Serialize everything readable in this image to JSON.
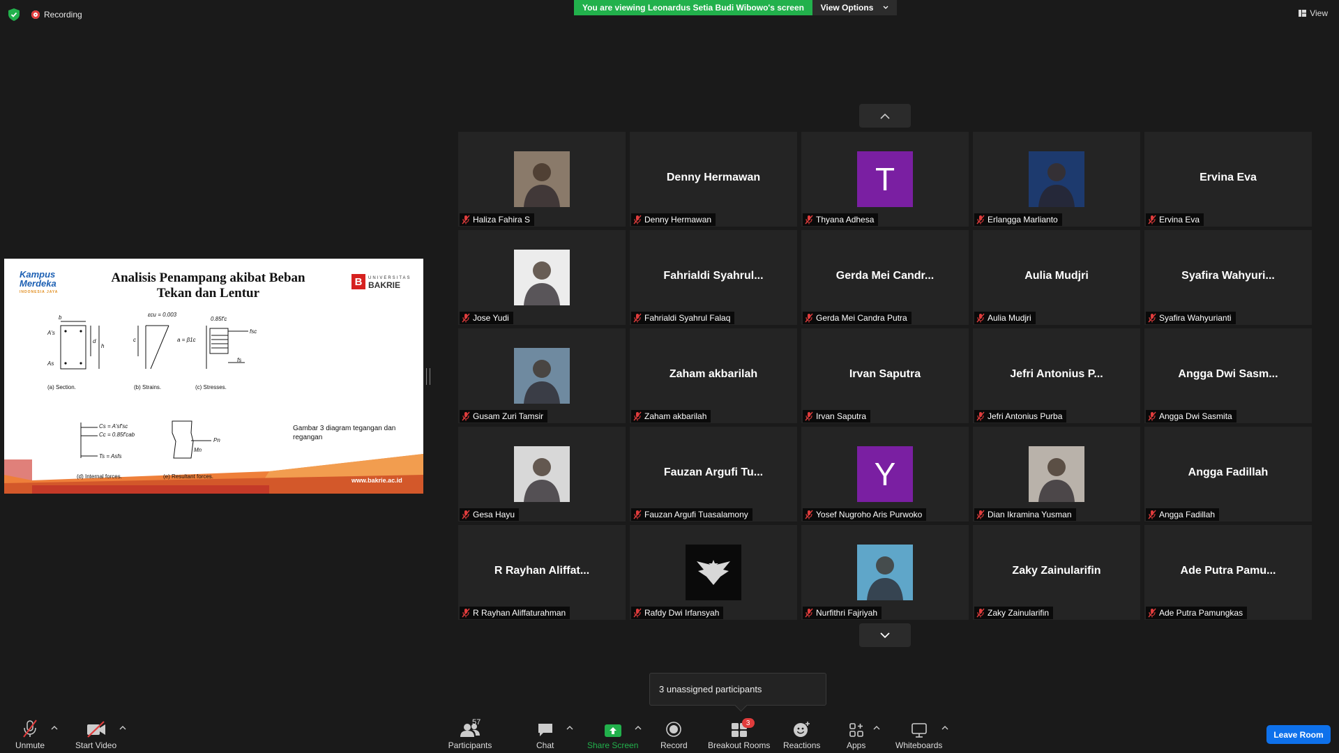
{
  "top_bar": {
    "recording_label": "Recording",
    "viewing_banner": "You are viewing Leonardus Setia Budi Wibowo's screen",
    "view_options_label": "View Options",
    "view_label": "View"
  },
  "shared_slide": {
    "logo_left_main": "Kampus",
    "logo_left_main2": "Merdeka",
    "logo_left_sub": "INDONESIA JAYA",
    "logo_right_small": "UNIVERSITAS",
    "logo_right_big": "BAKRIE",
    "logo_right_letter": "B",
    "title_line1": "Analisis Penampang akibat Beban",
    "title_line2": "Tekan dan Lentur",
    "eq_ecu": "εcu = 0.003",
    "eq_fc": "0.85f'c",
    "eq_a": "a = β1c",
    "eq_cs": "Cs = A'sf'sc",
    "eq_cc": "Cc = 0.85f'cab",
    "eq_ts": "Ts = Asfs",
    "label_b": "b",
    "label_d": "d",
    "label_h": "h",
    "label_c": "c",
    "label_as_top": "A's",
    "label_as_bot": "As",
    "label_fsc": "fsc",
    "label_fs": "fs",
    "label_pn": "Pn",
    "label_mn": "Mn",
    "cap_a": "(a)  Section.",
    "cap_b": "(b)  Strains.",
    "cap_c": "(c)  Stresses.",
    "cap_d": "(d)  Internal forces.",
    "cap_e": "(e)  Resultant forces.",
    "note": "Gambar 3 diagram tegangan dan regangan",
    "url": "www.bakrie.ac.id"
  },
  "gallery": {
    "tiles": [
      {
        "display": "",
        "label": "Haliza Fahira S",
        "avatar": "photo",
        "color": "#8a7a6a"
      },
      {
        "display": "Denny Hermawan",
        "label": "Denny Hermawan"
      },
      {
        "display": "",
        "label": "Thyana Adhesa",
        "avatar": "letter",
        "letter": "T",
        "color": "#7a1fa2"
      },
      {
        "display": "",
        "label": "Erlangga Marlianto",
        "avatar": "photo",
        "color": "#1d3a6e"
      },
      {
        "display": "Ervina Eva",
        "label": "Ervina Eva"
      },
      {
        "display": "",
        "label": "Jose Yudi",
        "avatar": "photo",
        "color": "#ececec"
      },
      {
        "display": "Fahrialdi  Syahrul...",
        "label": "Fahrialdi Syahrul Falaq"
      },
      {
        "display": "Gerda Mei Candr...",
        "label": "Gerda Mei Candra Putra"
      },
      {
        "display": "Aulia Mudjri",
        "label": "Aulia Mudjri"
      },
      {
        "display": "Syafira  Wahyuri...",
        "label": "Syafira Wahyurianti"
      },
      {
        "display": "",
        "label": "Gusam Zuri Tamsir",
        "avatar": "photo",
        "color": "#6f8aa0"
      },
      {
        "display": "Zaham akbarilah",
        "label": "Zaham akbarilah"
      },
      {
        "display": "Irvan Saputra",
        "label": "Irvan Saputra"
      },
      {
        "display": "Jefri Antonius  P...",
        "label": "Jefri Antonius Purba"
      },
      {
        "display": "Angga Dwi Sasm...",
        "label": "Angga Dwi Sasmita"
      },
      {
        "display": "",
        "label": "Gesa Hayu",
        "avatar": "photo",
        "color": "#d8d8d8"
      },
      {
        "display": "Fauzan  Argufi  Tu...",
        "label": "Fauzan Argufi Tuasalamony"
      },
      {
        "display": "",
        "label": "Yosef Nugroho Aris Purwoko",
        "avatar": "letter",
        "letter": "Y",
        "color": "#7a1fa2"
      },
      {
        "display": "",
        "label": "Dian Ikramina Yusman",
        "avatar": "photo",
        "color": "#b9b2aa"
      },
      {
        "display": "Angga Fadillah",
        "label": "Angga Fadillah"
      },
      {
        "display": "R  Rayhan  Aliffat...",
        "label": "R Rayhan Aliffaturahman"
      },
      {
        "display": "",
        "label": "Rafdy Dwi Irfansyah",
        "avatar": "logo",
        "color": "#0a0a0a"
      },
      {
        "display": "",
        "label": "Nurfithri Fajriyah",
        "avatar": "photo",
        "color": "#5fa6c9"
      },
      {
        "display": "Zaky Zainularifin",
        "label": "Zaky Zainularifin"
      },
      {
        "display": "Ade  Putra  Pamu...",
        "label": "Ade Putra Pamungkas"
      }
    ]
  },
  "tooltip": {
    "text": "3 unassigned participants"
  },
  "toolbar": {
    "unmute": "Unmute",
    "start_video": "Start Video",
    "participants": "Participants",
    "participants_count": "57",
    "chat": "Chat",
    "share_screen": "Share Screen",
    "record": "Record",
    "breakout_rooms": "Breakout Rooms",
    "breakout_badge": "3",
    "reactions": "Reactions",
    "apps": "Apps",
    "whiteboards": "Whiteboards",
    "leave_room": "Leave Room"
  },
  "colors": {
    "green": "#22b14c",
    "blue": "#0e71eb",
    "red": "#e03c3c",
    "tile_bg": "#242424"
  },
  "icons": [
    "shield-icon",
    "recording-icon",
    "chevron-down-icon",
    "chevron-up-icon",
    "view-grid-icon",
    "mic-muted-icon",
    "video-off-icon",
    "participants-icon",
    "chat-icon",
    "share-screen-icon",
    "record-icon",
    "breakout-rooms-icon",
    "reactions-icon",
    "apps-icon",
    "whiteboards-icon"
  ]
}
